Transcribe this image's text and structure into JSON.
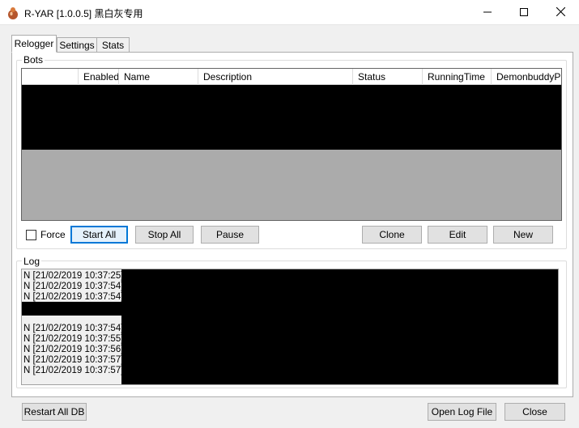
{
  "window": {
    "title": "R-YAR [1.0.0.5] 黑白灰专用",
    "icon": "app-icon",
    "controls": {
      "minimize_icon": "minimize-icon",
      "maximize_icon": "maximize-icon",
      "close_icon": "close-icon"
    }
  },
  "tabs": [
    {
      "label": "Relogger",
      "active": true
    },
    {
      "label": "Settings",
      "active": false
    },
    {
      "label": "Stats",
      "active": false
    }
  ],
  "bots": {
    "group_label": "Bots",
    "columns": [
      "",
      "Enabled",
      "Name",
      "Description",
      "Status",
      "RunningTime",
      "DemonbuddyPid"
    ],
    "force_label": "Force",
    "force_checked": false,
    "buttons": {
      "start_all": "Start All",
      "stop_all": "Stop All",
      "pause": "Pause",
      "clone": "Clone",
      "edit": "Edit",
      "new": "New"
    }
  },
  "log": {
    "group_label": "Log",
    "lines_top": [
      "N [21/02/2019 10:37:25]",
      "N [21/02/2019 10:37:54]",
      "N [21/02/2019 10:37:54]"
    ],
    "lines_bottom": [
      "N [21/02/2019 10:37:54]",
      "N [21/02/2019 10:37:55]",
      "N [21/02/2019 10:37:56]",
      "N [21/02/2019 10:37:57]",
      "N [21/02/2019 10:37:57]"
    ]
  },
  "footer": {
    "restart_all_db": "Restart All DB",
    "open_log_file": "Open Log File",
    "close": "Close"
  },
  "colors": {
    "accent": "#0078d7",
    "grid_empty": "#ababab",
    "redacted": "#000000"
  }
}
